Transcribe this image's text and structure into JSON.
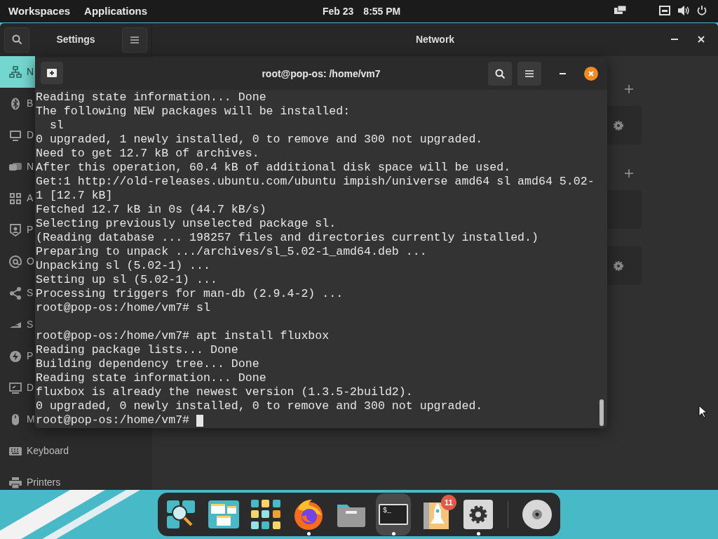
{
  "top_bar": {
    "menus": [
      "Workspaces",
      "Applications"
    ],
    "date": "Feb 23",
    "time": "8:55 PM"
  },
  "settings_window": {
    "title": "Settings",
    "page_title": "Network",
    "sidebar": [
      {
        "kind": "network",
        "label": "N",
        "selected": true
      },
      {
        "kind": "bluetooth",
        "label": "B",
        "selected": false
      },
      {
        "kind": "desktop",
        "label": "D",
        "selected": false
      },
      {
        "kind": "notifications",
        "label": "N",
        "selected": false
      },
      {
        "kind": "apps",
        "label": "A",
        "selected": false
      },
      {
        "kind": "privacy",
        "label": "P",
        "selected": false
      },
      {
        "kind": "online",
        "label": "O",
        "selected": false
      },
      {
        "kind": "sharing",
        "label": "S",
        "selected": false
      },
      {
        "kind": "sound",
        "label": "S",
        "selected": false
      },
      {
        "kind": "power",
        "label": "P",
        "selected": false
      },
      {
        "kind": "displays",
        "label": "D",
        "selected": false
      },
      {
        "kind": "mouse",
        "label": "M",
        "selected": false
      },
      {
        "kind": "keyboard",
        "label": "Keyboard",
        "selected": false
      },
      {
        "kind": "printers",
        "label": "Printers",
        "selected": false
      }
    ]
  },
  "terminal": {
    "title": "root@pop-os: /home/vm7",
    "blocks": [
      [
        "Reading state information... Done",
        "The following NEW packages will be installed:",
        "  sl",
        "0 upgraded, 1 newly installed, 0 to remove and 300 not upgraded.",
        "Need to get 12.7 kB of archives.",
        "After this operation, 60.4 kB of additional disk space will be used.",
        "Get:1 http://old-releases.ubuntu.com/ubuntu impish/universe amd64 sl amd64 5.02-",
        "1 [12.7 kB]",
        "Fetched 12.7 kB in 0s (44.7 kB/s)",
        "Selecting previously unselected package sl.",
        "(Reading database ... 198257 files and directories currently installed.)",
        "Preparing to unpack .../archives/sl_5.02-1_amd64.deb ...",
        "Unpacking sl (5.02-1) ...",
        "Setting up sl (5.02-1) ...",
        "Processing triggers for man-db (2.9.4-2) ...",
        "root@pop-os:/home/vm7# sl"
      ],
      [
        "root@pop-os:/home/vm7# apt install fluxbox",
        "Reading package lists... Done",
        "Building dependency tree... Done",
        "Reading state information... Done",
        "fluxbox is already the newest version (1.3.5-2build2).",
        "0 upgraded, 0 newly installed, 0 to remove and 300 not upgraded.",
        "root@pop-os:/home/vm7# "
      ]
    ]
  },
  "dock": {
    "items": [
      {
        "kind": "search",
        "running": false,
        "active": false
      },
      {
        "kind": "workspaces",
        "running": false,
        "active": false
      },
      {
        "kind": "apps",
        "running": false,
        "active": false
      },
      {
        "kind": "browser",
        "running": true,
        "active": false
      },
      {
        "kind": "files",
        "running": false,
        "active": false
      },
      {
        "kind": "terminal",
        "label": "$_",
        "running": true,
        "active": true
      },
      {
        "kind": "launcher",
        "badge": "11",
        "running": false,
        "active": false
      },
      {
        "kind": "settings",
        "running": true,
        "active": false
      },
      {
        "kind": "disc",
        "running": false,
        "active": false
      }
    ]
  }
}
